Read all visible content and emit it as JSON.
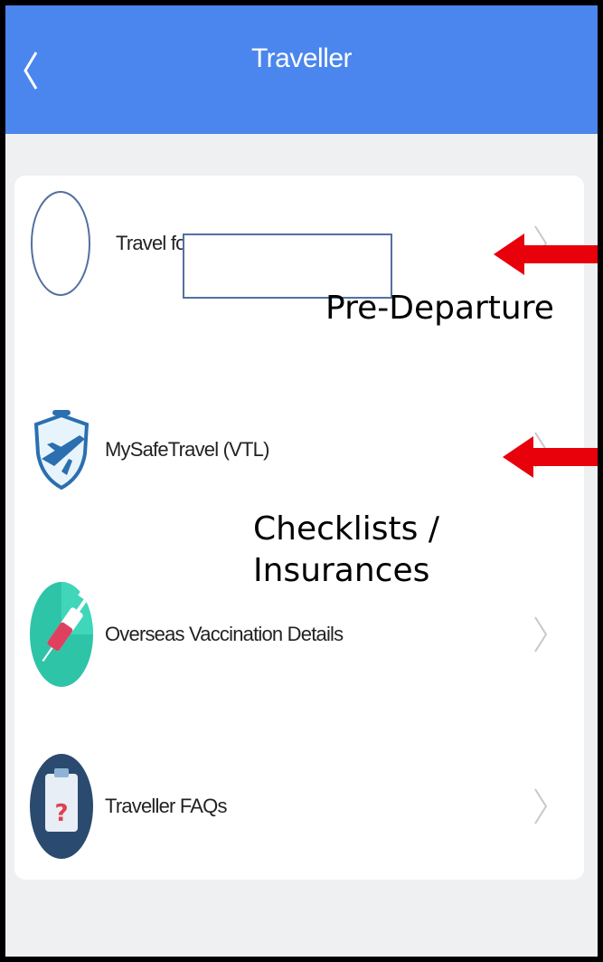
{
  "header": {
    "title": "Traveller"
  },
  "items": [
    {
      "label": "Travel for"
    },
    {
      "label": "MySafeTravel (VTL)"
    },
    {
      "label": "Overseas Vaccination Details"
    },
    {
      "label": "Traveller FAQs"
    }
  ],
  "annotations": {
    "first": "Pre-Departure",
    "second_line1": "Checklists /",
    "second_line2": "Insurances"
  },
  "colors": {
    "header": "#4a86ee",
    "arrow": "#e8000b",
    "teal": "#2ec4a8",
    "navy": "#2b4a6f"
  }
}
